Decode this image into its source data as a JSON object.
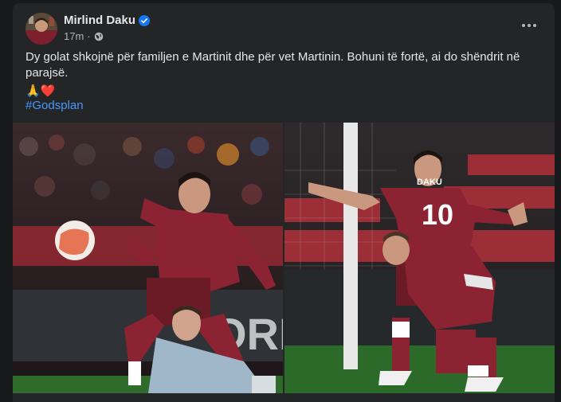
{
  "post": {
    "author": "Mirlind Daku",
    "verified": true,
    "timestamp": "17m",
    "privacy_icon": "globe-icon",
    "more_icon": "more-options-icon",
    "text": "Dy golat shkojnë për familjen e Martinit dhe për vet Martinin. Bohuni të fortë, ai do shëndrit në parajsë.",
    "emojis": "🙏❤️",
    "hashtag": "#Godsplan"
  },
  "photos": [
    {
      "name": "photo-player-shooting",
      "jersey_text": ""
    },
    {
      "name": "photo-player-celebrating",
      "jersey_name": "DAKU",
      "jersey_number": "10"
    }
  ],
  "colors": {
    "accent": "#4599ff",
    "verified": "#1877f2",
    "jersey": "#8b2332",
    "card": "#242526",
    "background": "#18191a"
  }
}
